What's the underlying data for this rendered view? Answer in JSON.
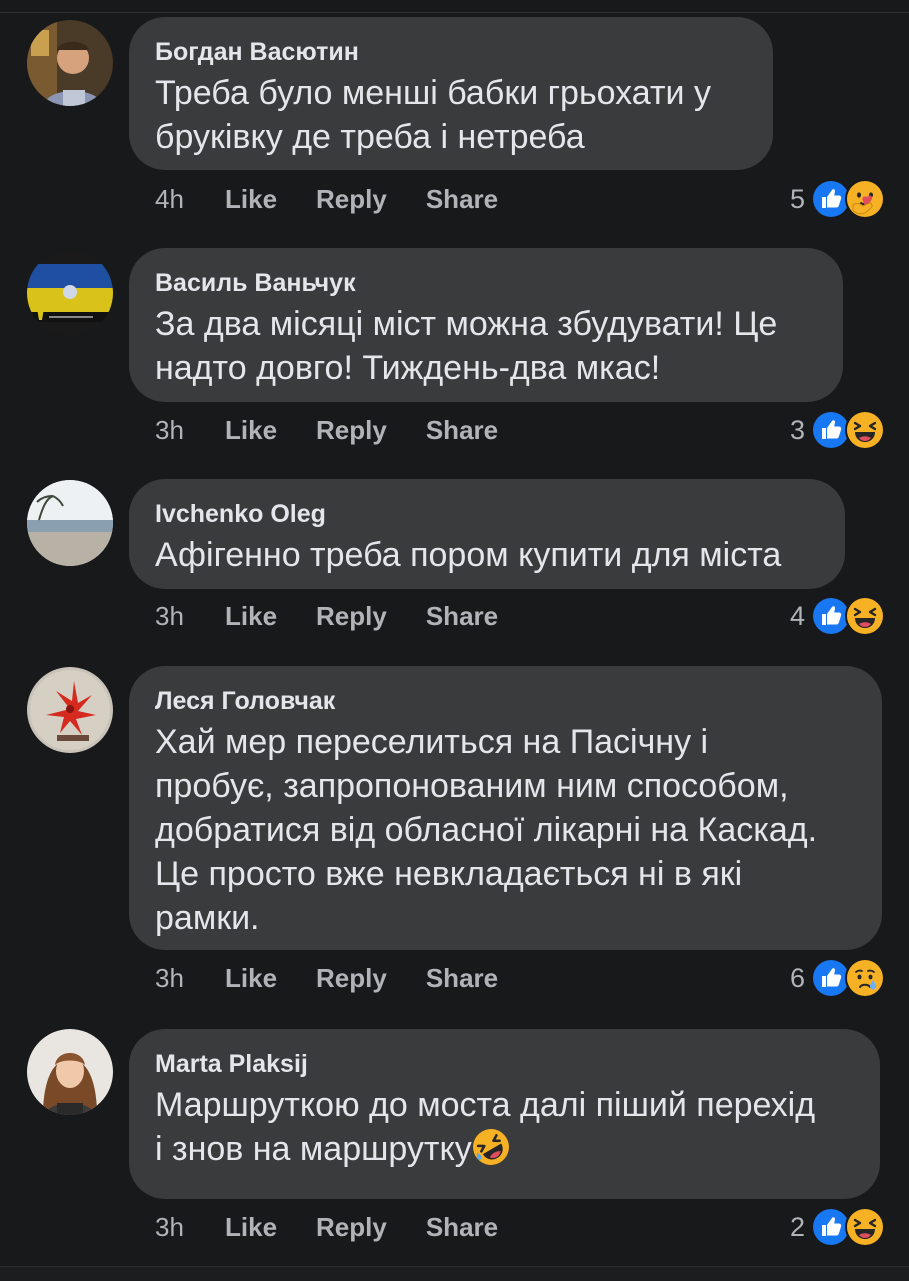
{
  "comments": [
    {
      "author": "Богдан Васютин",
      "lines": [
        "Треба було менші бабки грьохати у",
        "бруківку де треба і нетреба"
      ],
      "time": "4h",
      "like": "Like",
      "reply": "Reply",
      "share": "Share",
      "reaction_count": "5",
      "reactions": [
        "like-icon",
        "care-icon"
      ]
    },
    {
      "author": "Василь Ваньчук",
      "lines": [
        "За два місяці міст можна збудувати! Це",
        "надто довго! Тиждень-два мкас!"
      ],
      "time": "3h",
      "like": "Like",
      "reply": "Reply",
      "share": "Share",
      "reaction_count": "3",
      "reactions": [
        "like-icon",
        "haha-icon"
      ]
    },
    {
      "author": "Ivchenko Oleg",
      "lines": [
        "Афігенно треба пором купити для міста"
      ],
      "time": "3h",
      "like": "Like",
      "reply": "Reply",
      "share": "Share",
      "reaction_count": "4",
      "reactions": [
        "like-icon",
        "haha-icon"
      ]
    },
    {
      "author": "Леся Головчак",
      "lines": [
        "Хай мер переселиться на Пасічну і",
        "пробує, запропонованим ним способом,",
        "добратися від обласної лікарні на Каскад.",
        "Це просто вже невкладається ні в які",
        "рамки."
      ],
      "time": "3h",
      "like": "Like",
      "reply": "Reply",
      "share": "Share",
      "reaction_count": "6",
      "reactions": [
        "like-icon",
        "sad-icon"
      ]
    },
    {
      "author": "Marta Plaksij",
      "lines": [
        "Маршруткою до моста далі піший перехід",
        "і знов на маршрутку"
      ],
      "trailing_emoji": "rofl-emoji-icon",
      "time": "3h",
      "like": "Like",
      "reply": "Reply",
      "share": "Share",
      "reaction_count": "2",
      "reactions": [
        "like-icon",
        "haha-icon"
      ]
    }
  ],
  "colors": {
    "background": "#18191a",
    "bubble": "#3a3b3c",
    "text": "#e4e6eb",
    "secondary_text": "#b0b3b8",
    "like_blue": "#1877f2",
    "emoji_yellow": "#f7b125"
  }
}
